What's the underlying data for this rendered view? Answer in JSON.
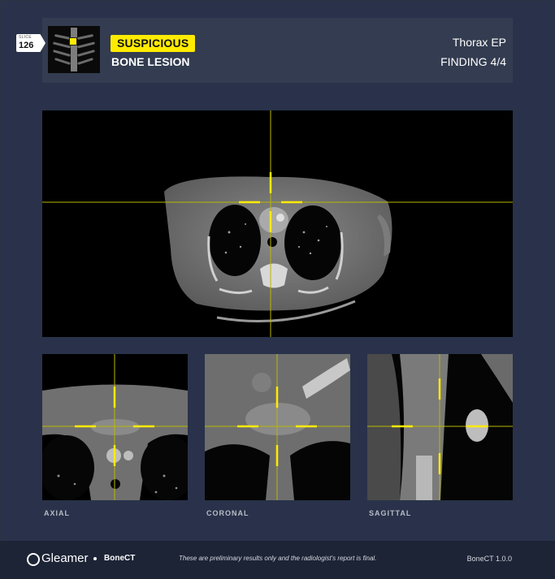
{
  "header": {
    "slice_label": "SLICE",
    "slice_number": "126",
    "badge": "SUSPICIOUS",
    "finding_type": "BONE LESION",
    "study": "Thorax EP",
    "finding_counter": "FINDING 4/4"
  },
  "views": [
    {
      "id": "main",
      "label": ""
    },
    {
      "id": "axial",
      "label": "AXIAL"
    },
    {
      "id": "coronal",
      "label": "CORONAL"
    },
    {
      "id": "sagittal",
      "label": "SAGITTAL"
    }
  ],
  "footer": {
    "brand": "Gleamer",
    "product": "BoneCT",
    "disclaimer": "These are preliminary results only and the radiologist's report is final.",
    "version": "BoneCT 1.0.0"
  },
  "colors": {
    "accent": "#ffeb00",
    "background": "#2a3346",
    "footer": "#1d2436",
    "crosshair": "#c8c800"
  },
  "icons": {
    "logo": "gleamer-logo-icon",
    "slice": "slice-tag-icon"
  }
}
